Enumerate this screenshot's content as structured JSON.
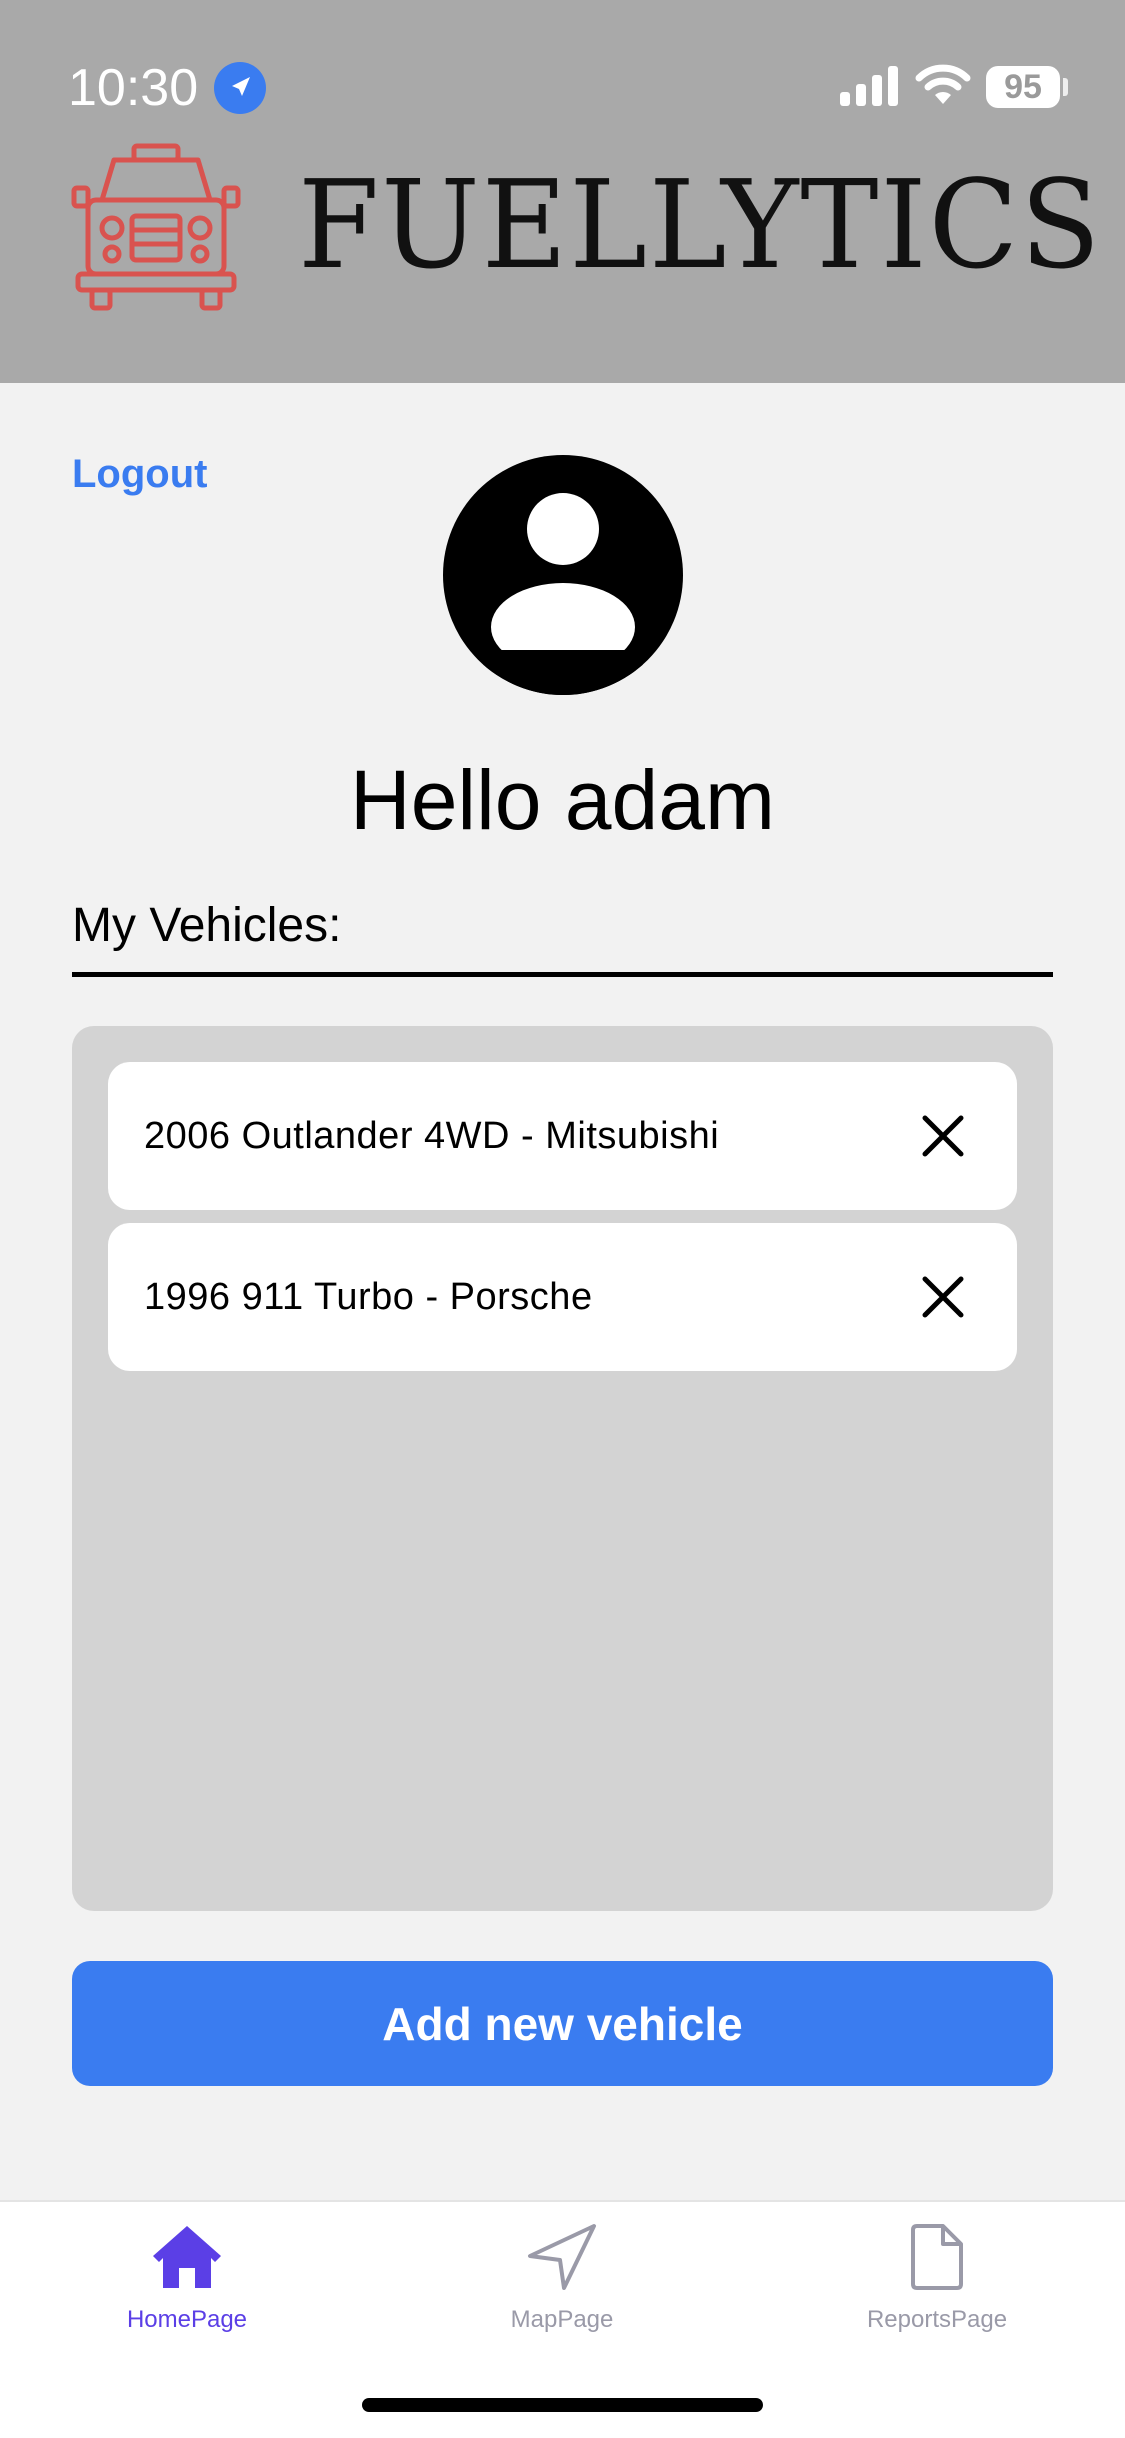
{
  "status_bar": {
    "time": "10:30",
    "battery": "95"
  },
  "header": {
    "brand": "FUELLYTICS",
    "logo_icon": "truck-icon",
    "logo_color": "#d9534f"
  },
  "account": {
    "logout_label": "Logout",
    "greeting": "Hello adam"
  },
  "vehicles": {
    "section_label": "My Vehicles:",
    "items": [
      {
        "label": "2006 Outlander 4WD - Mitsubishi"
      },
      {
        "label": "1996 911 Turbo - Porsche"
      }
    ],
    "add_label": "Add new vehicle"
  },
  "tabbar": {
    "tabs": [
      {
        "label": "HomePage",
        "icon": "home-icon",
        "active": true
      },
      {
        "label": "MapPage",
        "icon": "navigation-icon",
        "active": false
      },
      {
        "label": "ReportsPage",
        "icon": "document-icon",
        "active": false
      }
    ]
  },
  "colors": {
    "accent": "#3a7cf0",
    "active_tab": "#5b3fe6",
    "header_bg": "#a9a9a9"
  }
}
